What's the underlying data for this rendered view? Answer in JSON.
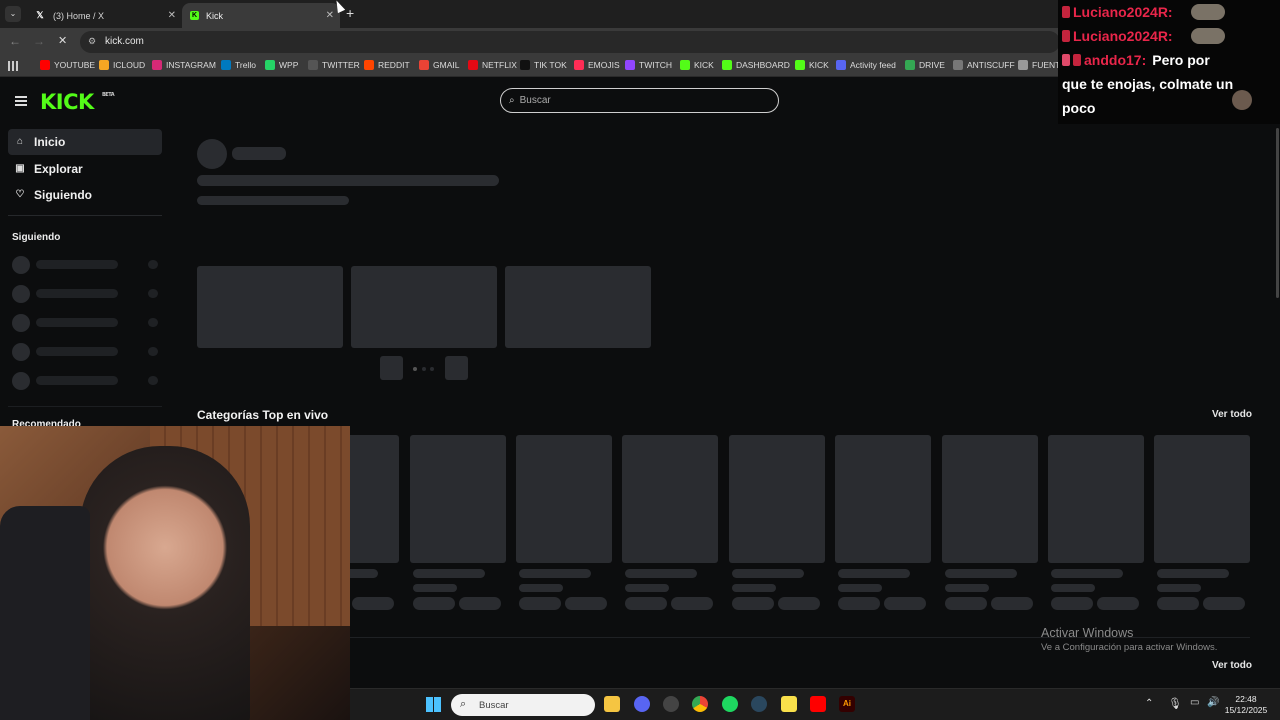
{
  "browser": {
    "tabs": [
      {
        "title": "(3) Home / X",
        "icon": "x-icon"
      },
      {
        "title": "Kick",
        "icon": "kick-icon"
      }
    ],
    "url": "kick.com",
    "bookmarks": [
      {
        "label": "YOUTUBE",
        "color": "#ff0000"
      },
      {
        "label": "ICLOUD",
        "color": "#f5a623"
      },
      {
        "label": "INSTAGRAM",
        "color": "#d62976"
      },
      {
        "label": "Trello",
        "color": "#0079bf"
      },
      {
        "label": "WPP",
        "color": "#25d366"
      },
      {
        "label": "TWITTER",
        "color": "#555555"
      },
      {
        "label": "REDDIT",
        "color": "#ff4500"
      },
      {
        "label": "GMAIL",
        "color": "#ea4335"
      },
      {
        "label": "NETFLIX",
        "color": "#e50914"
      },
      {
        "label": "TIK TOK",
        "color": "#111111"
      },
      {
        "label": "EMOJIS",
        "color": "#ff2d55"
      },
      {
        "label": "TWITCH",
        "color": "#9146ff"
      },
      {
        "label": "KICK",
        "color": "#53fc18"
      },
      {
        "label": "DASHBOARD",
        "color": "#53fc18"
      },
      {
        "label": "KICK",
        "color": "#53fc18"
      },
      {
        "label": "Activity feed",
        "color": "#5865f2"
      },
      {
        "label": "DRIVE",
        "color": "#34a853"
      },
      {
        "label": "ANTISCUFF",
        "color": "#777777"
      },
      {
        "label": "FUENTES",
        "color": "#999999"
      }
    ]
  },
  "kick": {
    "logo": "KICK",
    "logo_badge": "BETA",
    "search_placeholder": "Buscar",
    "nav": [
      {
        "label": "Inicio",
        "icon": "home-icon"
      },
      {
        "label": "Explorar",
        "icon": "explore-icon"
      },
      {
        "label": "Siguiendo",
        "icon": "heart-icon"
      }
    ],
    "following_heading": "Siguiendo",
    "recommended_heading": "Recomendado",
    "categories_heading": "Categorías Top en vivo",
    "view_all": "Ver todo",
    "view_all_2": "Ver todo",
    "accent": "#53fc18"
  },
  "chat_overlay": {
    "lines": [
      {
        "user": "Luciano2024R:",
        "msg": ""
      },
      {
        "user": "Luciano2024R:",
        "msg": "Pero por"
      },
      {
        "user": "anddo17:",
        "msg": ""
      }
    ],
    "continuation": "que te enojas, colmate un",
    "continuation_2": "poco"
  },
  "windows": {
    "watermark_title": "Activar Windows",
    "watermark_sub": "Ve a Configuración para activar Windows.",
    "taskbar_search": "Buscar",
    "time": "22:48",
    "date": "15/12/2025"
  }
}
